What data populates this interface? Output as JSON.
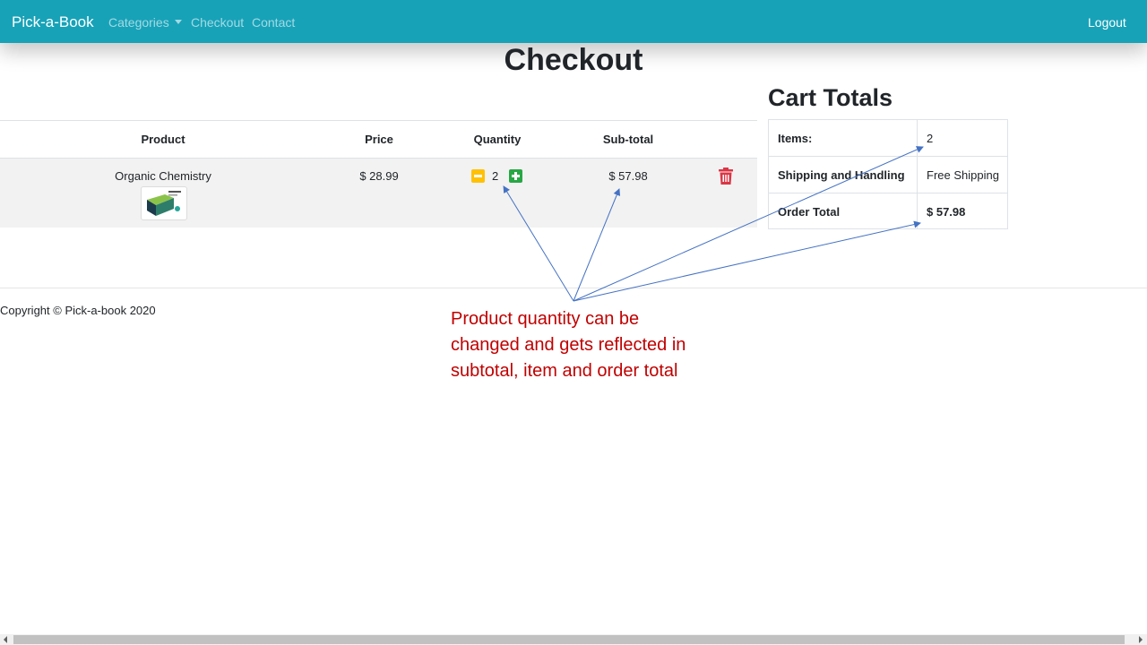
{
  "navbar": {
    "brand": "Pick-a-Book",
    "links": [
      "Categories",
      "Checkout",
      "Contact"
    ],
    "logout": "Logout"
  },
  "page_title": "Checkout",
  "cart_table": {
    "headers": [
      "Product",
      "Price",
      "Quantity",
      "Sub-total"
    ],
    "rows": [
      {
        "product": "Organic Chemistry",
        "price": "$ 28.99",
        "quantity": "2",
        "subtotal": "$ 57.98"
      }
    ]
  },
  "cart_totals": {
    "title": "Cart Totals",
    "rows": [
      {
        "label": "Items:",
        "value": "2"
      },
      {
        "label": "Shipping and Handling",
        "value": "Free Shipping"
      },
      {
        "label": "Order Total",
        "value": "$ 57.98"
      }
    ]
  },
  "footer": {
    "copyright": "Copyright © Pick-a-book 2020"
  },
  "annotation": "Product quantity can be changed and gets reflected in subtotal, item and order total",
  "colors": {
    "navbar": "#17a2b8",
    "minus_button": "#ffc107",
    "plus_button": "#28a745",
    "delete_icon": "#dc3545",
    "annotation_text": "#c00000",
    "annotation_arrows": "#4472c4"
  }
}
